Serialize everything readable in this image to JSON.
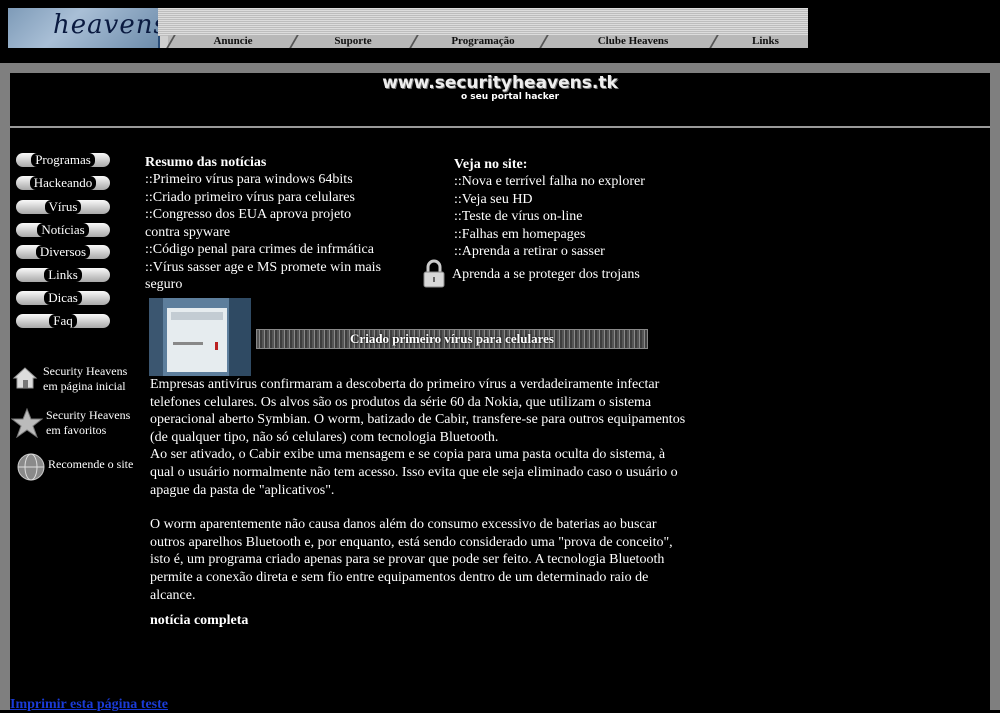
{
  "header": {
    "logo_text": "heavens",
    "menu": [
      {
        "label": "Anuncie"
      },
      {
        "label": "Suporte"
      },
      {
        "label": "Programação"
      },
      {
        "label": "Clube Heavens"
      },
      {
        "label": "Links"
      }
    ]
  },
  "banner": {
    "title": "www.securityheavens.tk",
    "subtitle": "o seu portal hacker"
  },
  "sidebar": {
    "nav": [
      {
        "label": "Programas"
      },
      {
        "label": "Hackeando"
      },
      {
        "label": "Vírus"
      },
      {
        "label": "Notícias"
      },
      {
        "label": "Diversos"
      },
      {
        "label": "Links"
      },
      {
        "label": "Dicas"
      },
      {
        "label": "Faq"
      }
    ],
    "links": [
      {
        "line1": "Security Heavens",
        "line2": "em página inicial",
        "icon": "home-icon"
      },
      {
        "line1": "Security Heavens",
        "line2": "em favoritos",
        "icon": "star-icon"
      },
      {
        "line1": "Recomende o site",
        "line2": "",
        "icon": "globe-icon"
      }
    ]
  },
  "summary": {
    "heading": "Resumo das notícias",
    "items": [
      "::Primeiro vírus para windows 64bits",
      "::Criado primeiro vírus para celulares",
      "::Congresso dos EUA aprova projeto contra spyware",
      "::Código penal para crimes de infrmática",
      "::Vírus sasser age e MS promete win mais seguro"
    ]
  },
  "see_site": {
    "heading": "Veja no site:",
    "items": [
      "::Nova e terrível falha no explorer",
      "::Veja seu HD",
      "::Teste de vírus on-line",
      "::Falhas em homepages",
      "::Aprenda a retirar o sasser"
    ],
    "trojan_link": "Aprenda a se proteger dos trojans"
  },
  "article": {
    "headline": "Criado primeiro vírus para celulares",
    "paragraph1": "Empresas antivírus confirmaram a descoberta do primeiro vírus a verdadeiramente infectar telefones celulares. Os alvos são os produtos da série 60 da Nokia, que utilizam o sistema operacional aberto Symbian. O worm, batizado de Cabir, transfere-se para outros equipamentos (de qualquer tipo, não só celulares) com tecnologia Bluetooth.",
    "paragraph2": "Ao ser ativado, o Cabir exibe uma mensagem e se copia para uma pasta oculta do sistema, à qual o usuário normalmente não tem acesso. Isso evita que ele seja eliminado caso o usuário o apague da pasta de \"aplicativos\".",
    "paragraph3": "O worm aparentemente não causa danos além do consumo excessivo de baterias ao buscar outros aparelhos Bluetooth e, por enquanto, está sendo considerado uma \"prova de conceito\", isto é, um programa criado apenas para se provar que pode ser feito. A tecnologia Bluetooth permite a conexão direta e sem fio entre equipamentos dentro de um determinado raio de alcance.",
    "full_link": "notícia completa"
  },
  "footer": {
    "print_link": "Imprimir esta página teste"
  }
}
